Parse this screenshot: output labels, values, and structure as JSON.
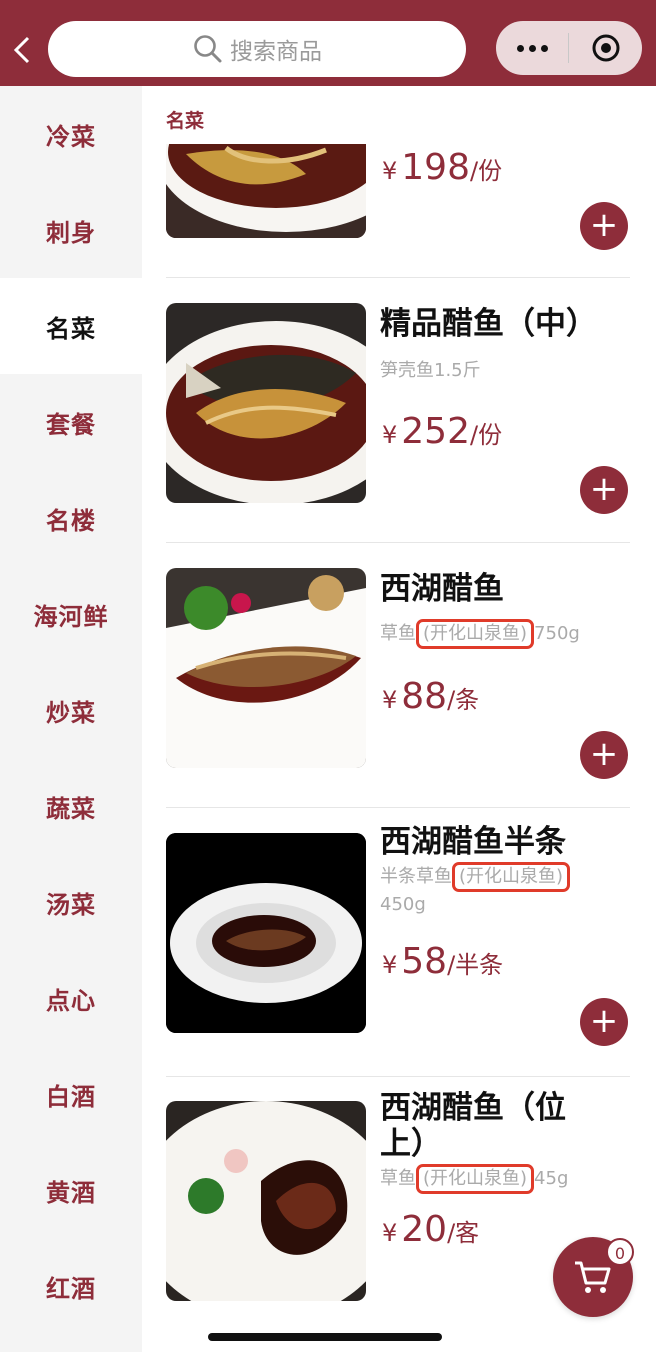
{
  "header": {
    "search_placeholder": "搜索商品"
  },
  "categories": [
    {
      "label": "冷菜",
      "active": false
    },
    {
      "label": "刺身",
      "active": false
    },
    {
      "label": "名菜",
      "active": true
    },
    {
      "label": "套餐",
      "active": false
    },
    {
      "label": "名楼",
      "active": false
    },
    {
      "label": "海河鲜",
      "active": false
    },
    {
      "label": "炒菜",
      "active": false
    },
    {
      "label": "蔬菜",
      "active": false
    },
    {
      "label": "汤菜",
      "active": false
    },
    {
      "label": "点心",
      "active": false
    },
    {
      "label": "白酒",
      "active": false
    },
    {
      "label": "黄酒",
      "active": false
    },
    {
      "label": "红酒",
      "active": false
    }
  ],
  "section_title": "名菜",
  "items": [
    {
      "name": "",
      "currency": "¥",
      "price": "198",
      "unit": "/份"
    },
    {
      "name": "精品醋鱼（中）",
      "desc": "笋壳鱼1.5斤",
      "currency": "¥",
      "price": "252",
      "unit": "/份"
    },
    {
      "name": "西湖醋鱼",
      "desc_pre": "草鱼",
      "desc_hl": "(开化山泉鱼)",
      "desc_post": "750g",
      "currency": "¥",
      "price": "88",
      "unit": "/条"
    },
    {
      "name": "西湖醋鱼半条",
      "desc_pre": "半条草鱼",
      "desc_hl": "(开化山泉鱼)",
      "desc_post": "450g",
      "currency": "¥",
      "price": "58",
      "unit": "/半条"
    },
    {
      "name": "西湖醋鱼（位上）",
      "desc_pre": "草鱼",
      "desc_hl": "(开化山泉鱼)",
      "desc_post": "45g",
      "currency": "¥",
      "price": "20",
      "unit": "/客"
    }
  ],
  "cart": {
    "count": "0"
  },
  "colors": {
    "brand": "#8e2d3a",
    "highlight_box": "#e03b2a"
  }
}
